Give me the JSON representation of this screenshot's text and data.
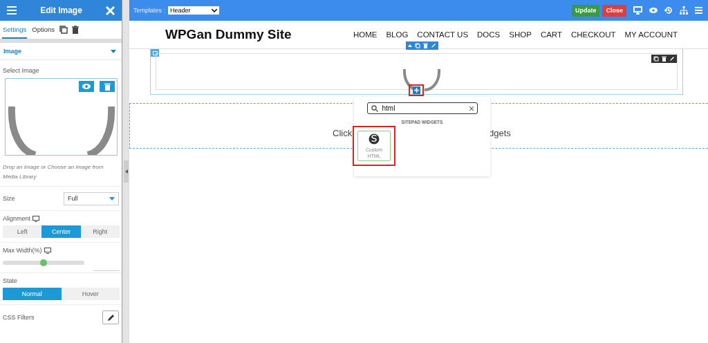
{
  "panel": {
    "title": "Edit Image",
    "tabs": [
      {
        "label": "Settings",
        "selected": true
      },
      {
        "label": "Options",
        "selected": false
      }
    ],
    "section": {
      "label": "Image",
      "expanded": true
    },
    "select_image_label": "Select Image",
    "hint": "Drop an Image or Choose an image from Media Library",
    "size": {
      "label": "Size",
      "value": "Full"
    },
    "alignment": {
      "label": "Alignment",
      "options": [
        {
          "label": "Left",
          "selected": false
        },
        {
          "label": "Center",
          "selected": true
        },
        {
          "label": "Right",
          "selected": false
        }
      ]
    },
    "max_width": {
      "label": "Max Width(%)",
      "level": 0.5
    },
    "state": {
      "label": "State",
      "options": [
        {
          "label": "Normal",
          "selected": true
        },
        {
          "label": "Hover",
          "selected": false
        }
      ]
    },
    "css_filters": {
      "label": "CSS Filters"
    }
  },
  "topbar": {
    "templates_label": "Templates :",
    "template_value": "Header",
    "update": "Update",
    "close": "Close"
  },
  "site": {
    "title": "WPGan Dummy Site",
    "nav": [
      "HOME",
      "BLOG",
      "CONTACT US",
      "DOCS",
      "SHOP",
      "CART",
      "CHECKOUT",
      "MY ACCOUNT"
    ]
  },
  "drop_zone": {
    "text_left": "Click",
    "text_right": "dgets"
  },
  "widget_popup": {
    "search_value": "html",
    "group": "SITEPAD WIDGETS",
    "widgets": [
      {
        "label": "Custom HTML"
      }
    ]
  }
}
